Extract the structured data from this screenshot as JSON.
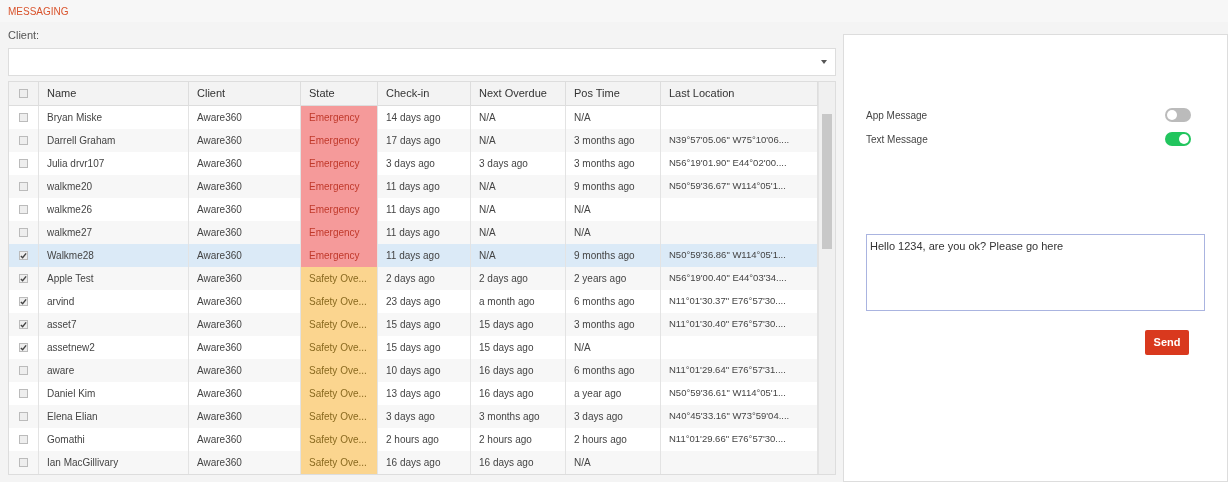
{
  "header": {
    "title": "MESSAGING"
  },
  "client_filter": {
    "label": "Client:"
  },
  "table": {
    "columns": [
      "Name",
      "Client",
      "State",
      "Check-in",
      "Next Overdue",
      "Pos Time",
      "Last Location"
    ],
    "header_checked": false,
    "rows": [
      {
        "checked": false,
        "selected": false,
        "name": "Bryan Miske",
        "client": "Aware360",
        "state": {
          "text": "Emergency",
          "kind": "emergency"
        },
        "check_in": "14 days ago",
        "next_overdue": "N/A",
        "pos_time": "N/A",
        "last_location": ""
      },
      {
        "checked": false,
        "selected": false,
        "name": "Darrell Graham",
        "client": "Aware360",
        "state": {
          "text": "Emergency",
          "kind": "emergency"
        },
        "check_in": "17 days ago",
        "next_overdue": "N/A",
        "pos_time": "3 months ago",
        "last_location": "N39°57'05.06\" W75°10'06...."
      },
      {
        "checked": false,
        "selected": false,
        "name": "Julia drvr107",
        "client": "Aware360",
        "state": {
          "text": "Emergency",
          "kind": "emergency"
        },
        "check_in": "3 days ago",
        "next_overdue": "3 days ago",
        "pos_time": "3 months ago",
        "last_location": "N56°19'01.90\" E44°02'00...."
      },
      {
        "checked": false,
        "selected": false,
        "name": "walkme20",
        "client": "Aware360",
        "state": {
          "text": "Emergency",
          "kind": "emergency"
        },
        "check_in": "11 days ago",
        "next_overdue": "N/A",
        "pos_time": "9 months ago",
        "last_location": "N50°59'36.67\" W114°05'1..."
      },
      {
        "checked": false,
        "selected": false,
        "name": "walkme26",
        "client": "Aware360",
        "state": {
          "text": "Emergency",
          "kind": "emergency"
        },
        "check_in": "11 days ago",
        "next_overdue": "N/A",
        "pos_time": "N/A",
        "last_location": ""
      },
      {
        "checked": false,
        "selected": false,
        "name": "walkme27",
        "client": "Aware360",
        "state": {
          "text": "Emergency",
          "kind": "emergency"
        },
        "check_in": "11 days ago",
        "next_overdue": "N/A",
        "pos_time": "N/A",
        "last_location": ""
      },
      {
        "checked": true,
        "selected": true,
        "name": "Walkme28",
        "client": "Aware360",
        "state": {
          "text": "Emergency",
          "kind": "emergency"
        },
        "check_in": "11 days ago",
        "next_overdue": "N/A",
        "pos_time": "9 months ago",
        "last_location": "N50°59'36.86\" W114°05'1..."
      },
      {
        "checked": true,
        "selected": false,
        "name": "Apple Test",
        "client": "Aware360",
        "state": {
          "text": "Safety Ove...",
          "kind": "safety"
        },
        "check_in": "2 days ago",
        "next_overdue": "2 days ago",
        "pos_time": "2 years ago",
        "last_location": "N56°19'00.40\" E44°03'34...."
      },
      {
        "checked": true,
        "selected": false,
        "name": "arvind",
        "client": "Aware360",
        "state": {
          "text": "Safety Ove...",
          "kind": "safety"
        },
        "check_in": "23 days ago",
        "next_overdue": "a month ago",
        "pos_time": "6 months ago",
        "last_location": "N11°01'30.37\" E76°57'30...."
      },
      {
        "checked": true,
        "selected": false,
        "name": "asset7",
        "client": "Aware360",
        "state": {
          "text": "Safety Ove...",
          "kind": "safety"
        },
        "check_in": "15 days ago",
        "next_overdue": "15 days ago",
        "pos_time": "3 months ago",
        "last_location": "N11°01'30.40\" E76°57'30...."
      },
      {
        "checked": true,
        "selected": false,
        "name": "assetnew2",
        "client": "Aware360",
        "state": {
          "text": "Safety Ove...",
          "kind": "safety"
        },
        "check_in": "15 days ago",
        "next_overdue": "15 days ago",
        "pos_time": "N/A",
        "last_location": ""
      },
      {
        "checked": false,
        "selected": false,
        "name": "aware",
        "client": "Aware360",
        "state": {
          "text": "Safety Ove...",
          "kind": "safety"
        },
        "check_in": "10 days ago",
        "next_overdue": "16 days ago",
        "pos_time": "6 months ago",
        "last_location": "N11°01'29.64\" E76°57'31...."
      },
      {
        "checked": false,
        "selected": false,
        "name": "Daniel Kim",
        "client": "Aware360",
        "state": {
          "text": "Safety Ove...",
          "kind": "safety"
        },
        "check_in": "13 days ago",
        "next_overdue": "16 days ago",
        "pos_time": "a year ago",
        "last_location": "N50°59'36.61\" W114°05'1..."
      },
      {
        "checked": false,
        "selected": false,
        "name": "Elena Elian",
        "client": "Aware360",
        "state": {
          "text": "Safety Ove...",
          "kind": "safety"
        },
        "check_in": "3 days ago",
        "next_overdue": "3 months ago",
        "pos_time": "3 days ago",
        "last_location": "N40°45'33.16\" W73°59'04...."
      },
      {
        "checked": false,
        "selected": false,
        "name": "Gomathi",
        "client": "Aware360",
        "state": {
          "text": "Safety Ove...",
          "kind": "safety"
        },
        "check_in": "2 hours ago",
        "next_overdue": "2 hours ago",
        "pos_time": "2 hours ago",
        "last_location": "N11°01'29.66\" E76°57'30...."
      },
      {
        "checked": false,
        "selected": false,
        "name": "Ian MacGillivary",
        "client": "Aware360",
        "state": {
          "text": "Safety Ove...",
          "kind": "safety"
        },
        "check_in": "16 days ago",
        "next_overdue": "16 days ago",
        "pos_time": "N/A",
        "last_location": ""
      }
    ]
  },
  "toggles": [
    {
      "label": "App Message",
      "on": false
    },
    {
      "label": "Text Message",
      "on": true
    }
  ],
  "message": {
    "value": "Hello 1234, are you ok? Please go here"
  },
  "send_button": {
    "label": "Send"
  }
}
